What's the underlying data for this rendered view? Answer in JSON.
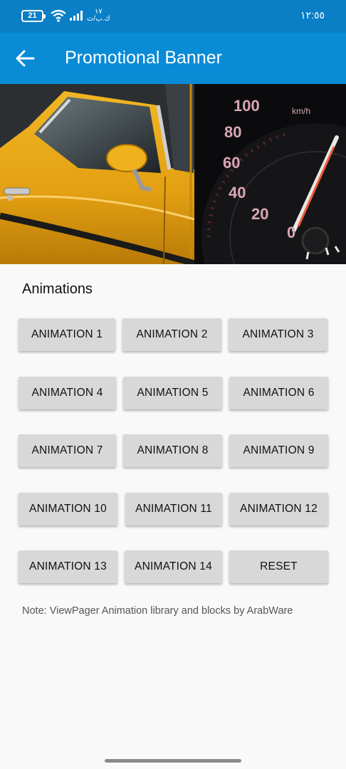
{
  "status_bar": {
    "battery": "21",
    "network_speed_value": "١٧",
    "network_speed_unit": "ك.ب/ث",
    "time": "١٢:٥٥"
  },
  "app_bar": {
    "title": "Promotional Banner",
    "back_icon": "arrow-back-icon"
  },
  "banner": {
    "panels": [
      "yellow-car-side",
      "speedometer"
    ],
    "gauge_labels": [
      "100",
      "80",
      "60",
      "40",
      "20",
      "0",
      "km/h"
    ]
  },
  "animations": {
    "heading": "Animations",
    "buttons": [
      "ANIMATION 1",
      "ANIMATION 2",
      "ANIMATION 3",
      "ANIMATION 4",
      "ANIMATION 5",
      "ANIMATION 6",
      "ANIMATION 7",
      "ANIMATION 8",
      "ANIMATION 9",
      "ANIMATION 10",
      "ANIMATION 11",
      "ANIMATION 12",
      "ANIMATION 13",
      "ANIMATION 14",
      "RESET"
    ]
  },
  "note": "Note: ViewPager Animation library and blocks by ArabWare",
  "colors": {
    "status_bar": "#0a7fc6",
    "app_bar": "#0a8bd6",
    "button_bg": "#d8d8d8",
    "background": "#f9f9f9"
  }
}
